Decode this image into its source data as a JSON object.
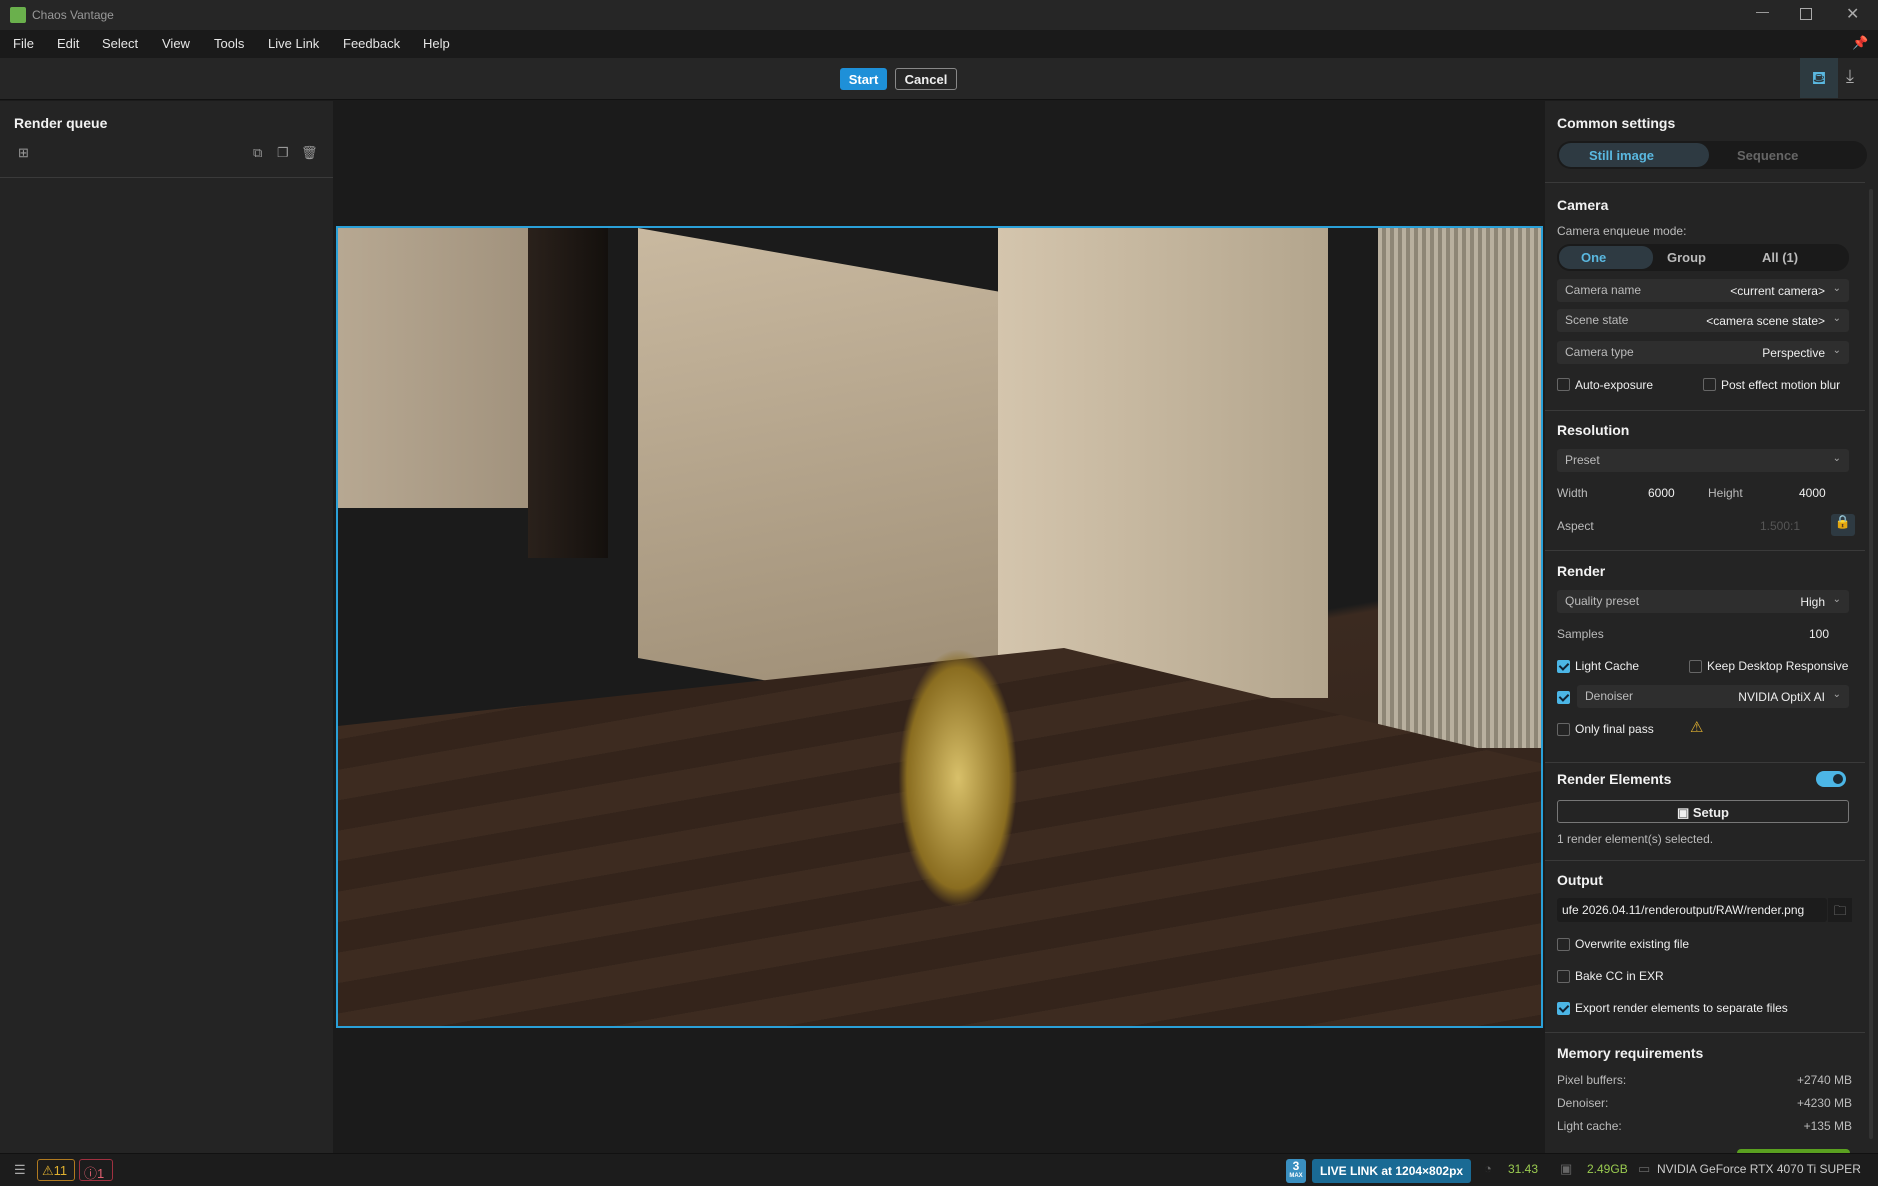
{
  "app": {
    "title": "Chaos Vantage"
  },
  "menu": [
    "File",
    "Edit",
    "Select",
    "View",
    "Tools",
    "Live Link",
    "Feedback",
    "Help"
  ],
  "toolbar": {
    "start": "Start",
    "cancel": "Cancel"
  },
  "render_queue": {
    "title": "Render queue"
  },
  "settings": {
    "title": "Common settings",
    "tabs": [
      "Still image",
      "Sequence"
    ],
    "camera": {
      "title": "Camera",
      "enqueue_label": "Camera enqueue mode:",
      "modes": [
        "One",
        "Group",
        "All (1)"
      ],
      "camera_name_label": "Camera name",
      "camera_name": "<current camera>",
      "scene_state_label": "Scene state",
      "scene_state": "<camera scene state>",
      "camera_type_label": "Camera type",
      "camera_type": "Perspective",
      "auto_exposure": "Auto-exposure",
      "motion_blur": "Post effect motion blur"
    },
    "resolution": {
      "title": "Resolution",
      "preset": "Preset",
      "width_label": "Width",
      "width": "6000",
      "height_label": "Height",
      "height": "4000",
      "aspect_label": "Aspect",
      "aspect": "1.500:1"
    },
    "render": {
      "title": "Render",
      "quality_label": "Quality preset",
      "quality": "High",
      "samples_label": "Samples",
      "samples": "100",
      "light_cache": "Light Cache",
      "keep_responsive": "Keep Desktop Responsive",
      "denoiser_label": "Denoiser",
      "denoiser": "NVIDIA OptiX AI",
      "only_final": "Only final pass"
    },
    "render_elements": {
      "title": "Render Elements",
      "enabled": true,
      "setup": "Setup",
      "selected": "1 render element(s) selected."
    },
    "output": {
      "title": "Output",
      "path": "ufe 2026.04.11/renderoutput/RAW/render.png",
      "overwrite": "Overwrite existing file",
      "bake_cc": "Bake CC in EXR",
      "export_elements": "Export render elements to separate files"
    },
    "memory": {
      "title": "Memory requirements",
      "rows": [
        {
          "label": "Pixel buffers:",
          "value": "+2740 MB"
        },
        {
          "label": "Denoiser:",
          "value": "+4230 MB"
        },
        {
          "label": "Light cache:",
          "value": "+135 MB"
        }
      ]
    }
  },
  "status": {
    "warnings": "11",
    "errors": "1",
    "max_badge": "3",
    "max_sub": "MAX",
    "live_link": "LIVE LINK at 1204×802px",
    "fps": "31.43",
    "memory": "2.49GB",
    "gpu": "NVIDIA GeForce RTX 4070 Ti SUPER"
  }
}
